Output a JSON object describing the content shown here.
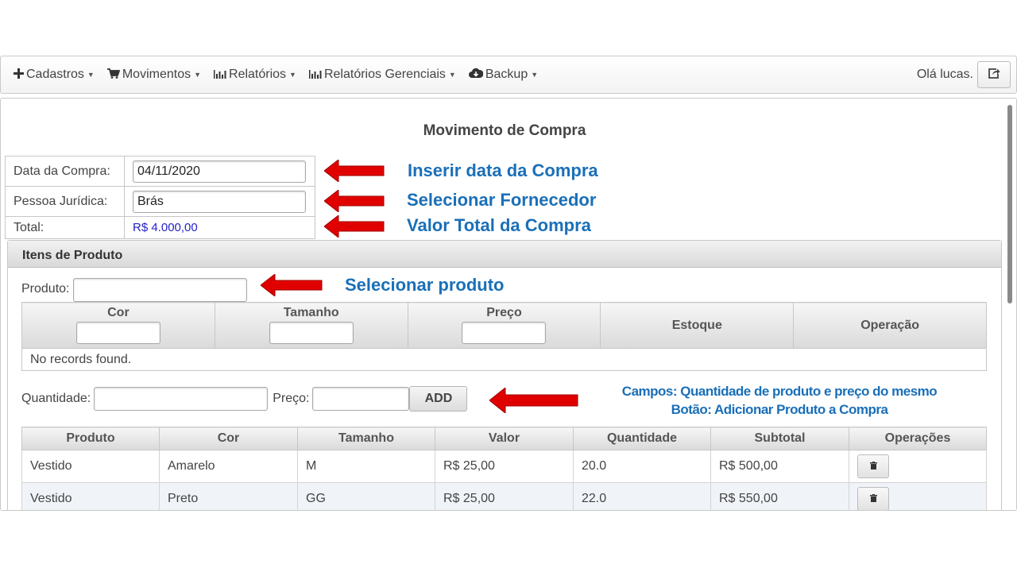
{
  "menubar": {
    "items": [
      {
        "label": "Cadastros",
        "icon": "plus-icon"
      },
      {
        "label": "Movimentos",
        "icon": "cart-icon"
      },
      {
        "label": "Relatórios",
        "icon": "bar-chart-icon"
      },
      {
        "label": "Relatórios Gerenciais",
        "icon": "bar-chart-icon"
      },
      {
        "label": "Backup",
        "icon": "cloud-download-icon"
      }
    ],
    "greeting": "Olá lucas.",
    "logout_icon": "share-out-icon"
  },
  "page": {
    "title": "Movimento de Compra"
  },
  "form": {
    "data_label": "Data da Compra:",
    "data_value": "04/11/2020",
    "pessoa_label": "Pessoa Jurídica:",
    "pessoa_value": "Brás",
    "total_label": "Total:",
    "total_value": "R$ 4.000,00"
  },
  "annotations": {
    "data": "Inserir data da Compra",
    "fornecedor": "Selecionar Fornecedor",
    "total": "Valor Total da Compra",
    "produto": "Selecionar produto",
    "campos_line1": "Campos: Quantidade de produto e preço do mesmo",
    "campos_line2": "Botão: Adicionar Produto a Compra",
    "arrow_color": "#e10000",
    "text_color": "#1a6fb8"
  },
  "itens": {
    "header": "Itens de Produto",
    "produto_label": "Produto:",
    "produto_value": "",
    "filter_columns": [
      "Cor",
      "Tamanho",
      "Preço",
      "Estoque",
      "Operação"
    ],
    "empty_message": "No records found.",
    "quantidade_label": "Quantidade:",
    "quantidade_value": "",
    "preco_label": "Preço:",
    "preco_value": "",
    "add_label": "ADD"
  },
  "items_table": {
    "columns": [
      "Produto",
      "Cor",
      "Tamanho",
      "Valor",
      "Quantidade",
      "Subtotal",
      "Operações"
    ],
    "rows": [
      [
        "Vestido",
        "Amarelo",
        "M",
        "R$ 25,00",
        "20.0",
        "R$ 500,00"
      ],
      [
        "Vestido",
        "Preto",
        "GG",
        "R$ 25,00",
        "22.0",
        "R$ 550,00"
      ]
    ],
    "delete_icon": "trash-icon"
  }
}
